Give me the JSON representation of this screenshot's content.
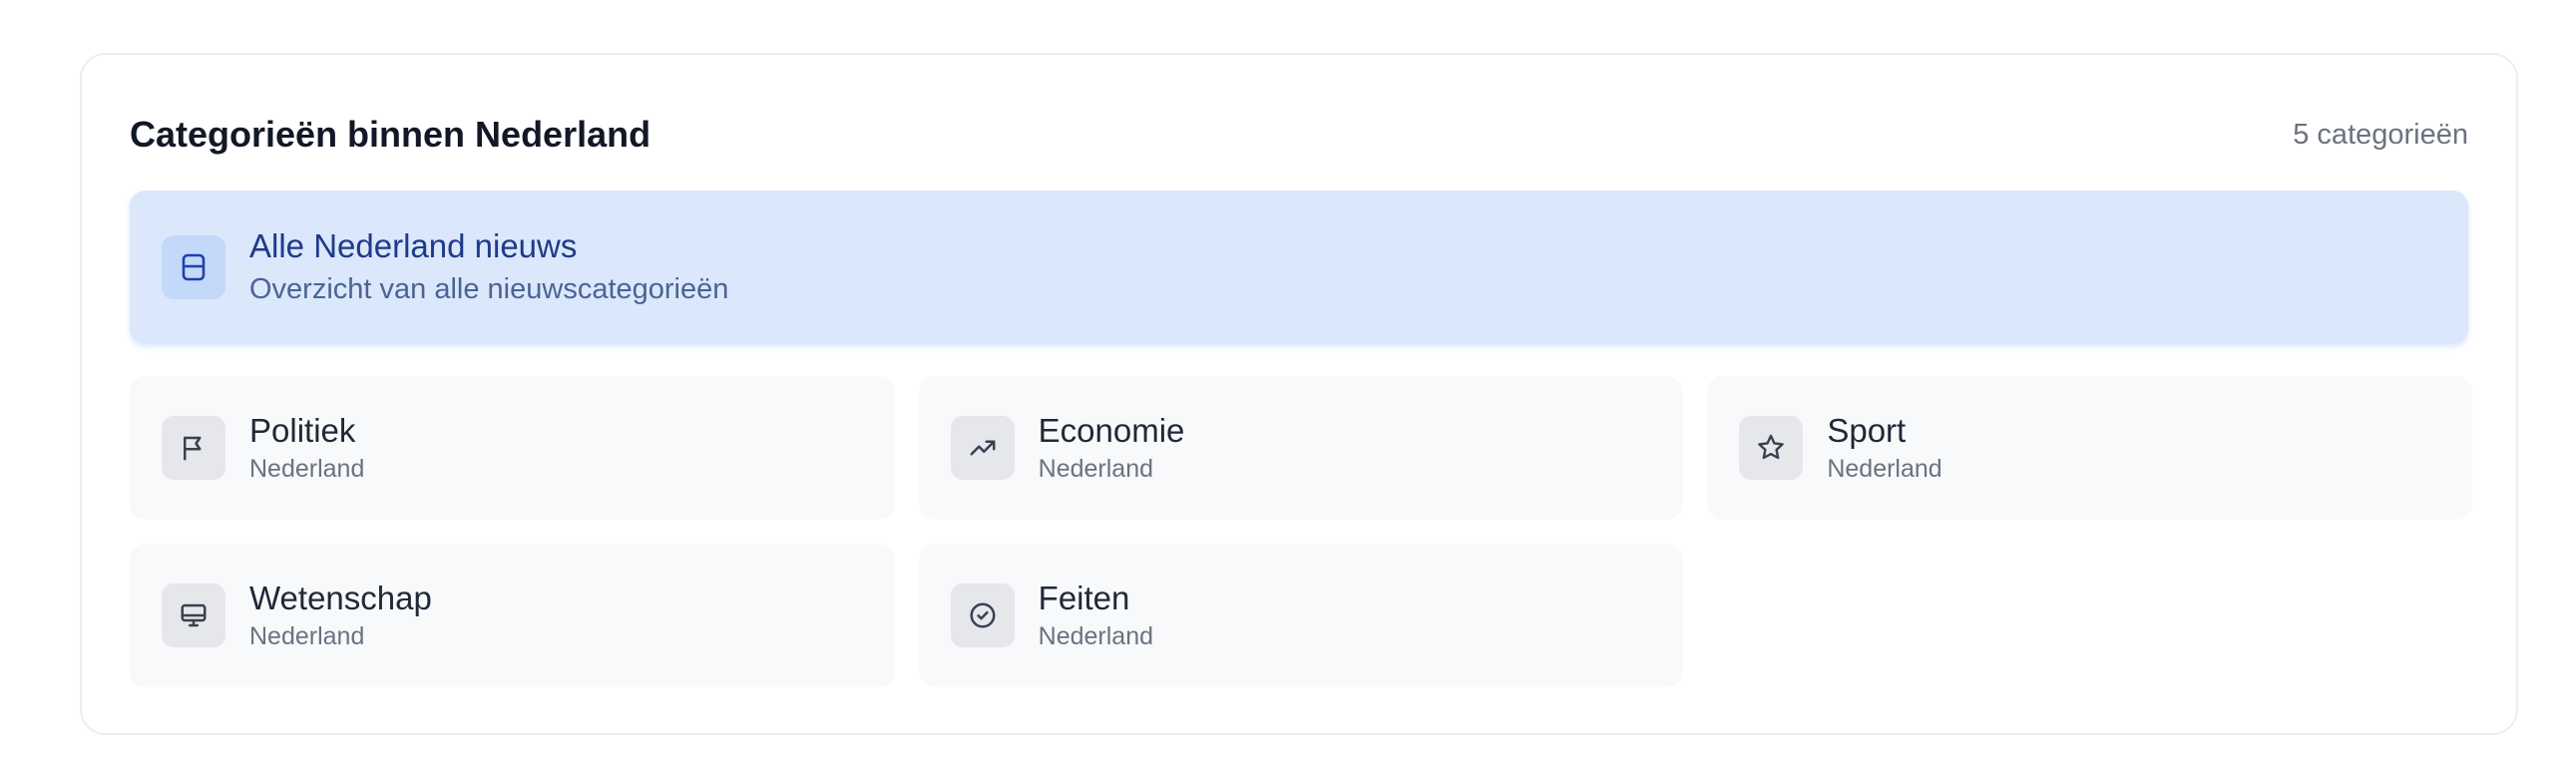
{
  "header": {
    "title": "Categorieën binnen Nederland",
    "count": "5 categorieën"
  },
  "featured": {
    "title": "Alle Nederland nieuws",
    "subtitle": "Overzicht van alle nieuwscategorieën",
    "icon": "newspaper-icon"
  },
  "categories": [
    {
      "title": "Politiek",
      "subtitle": "Nederland",
      "icon": "flag-icon"
    },
    {
      "title": "Economie",
      "subtitle": "Nederland",
      "icon": "trending-up-icon"
    },
    {
      "title": "Sport",
      "subtitle": "Nederland",
      "icon": "star-icon"
    },
    {
      "title": "Wetenschap",
      "subtitle": "Nederland",
      "icon": "monitor-icon"
    },
    {
      "title": "Feiten",
      "subtitle": "Nederland",
      "icon": "check-circle-icon"
    }
  ],
  "colors": {
    "featured_bg": "#dbe7fb",
    "featured_text": "#1e3a8a",
    "card_bg": "#f8f9fb"
  }
}
